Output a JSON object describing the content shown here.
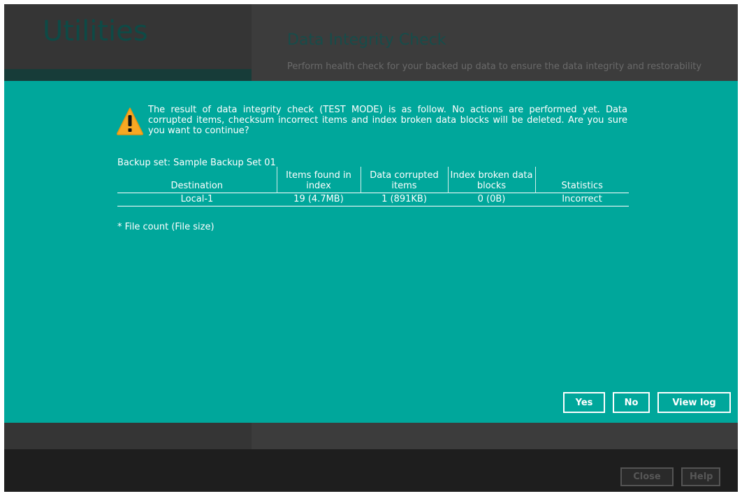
{
  "app": {
    "title": "Utilities",
    "section_title": "Data Integrity Check",
    "section_description": "Perform health check for your backed up data to ensure the data integrity and restorability"
  },
  "dialog": {
    "message": "The result of data integrity check (TEST MODE) is as follow. No actions are performed yet. Data corrupted items, checksum incorrect items and index broken data blocks will be deleted. Are you sure you want to continue?",
    "backup_set_label": "Backup set: Sample Backup Set 01",
    "table": {
      "headers": [
        "Destination",
        "Items found in index",
        "Data corrupted items",
        "Index broken data blocks",
        "Statistics"
      ],
      "rows": [
        [
          "Local-1",
          "19 (4.7MB)",
          "1 (891KB)",
          "0 (0B)",
          "Incorrect"
        ]
      ]
    },
    "footnote": "* File count (File size)",
    "buttons": {
      "yes": "Yes",
      "no": "No",
      "view_log": "View log"
    }
  },
  "footer": {
    "close": "Close",
    "help": "Help"
  },
  "icons": {
    "warning": "warning-triangle-icon"
  },
  "colors": {
    "modal_background": "#00a79b",
    "warning_yellow": "#f7a823",
    "dimmed_background": "#3a3a3a",
    "footer_background": "#1e1e1e"
  }
}
